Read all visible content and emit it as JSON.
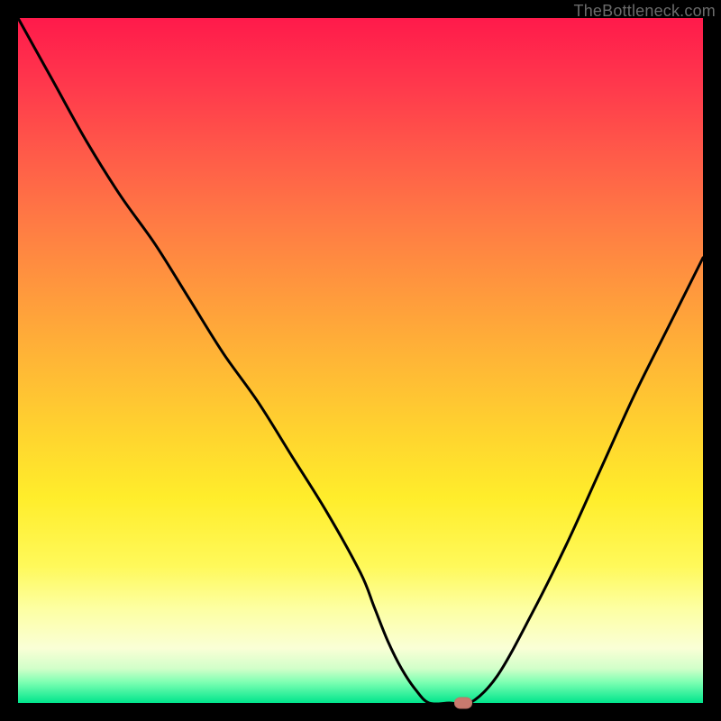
{
  "watermark": "TheBottleneck.com",
  "chart_data": {
    "type": "line",
    "title": "",
    "xlabel": "",
    "ylabel": "",
    "xlim": [
      0,
      100
    ],
    "ylim": [
      0,
      100
    ],
    "grid": false,
    "series": [
      {
        "name": "curve",
        "x": [
          0,
          5,
          10,
          15,
          20,
          25,
          30,
          35,
          40,
          45,
          50,
          52,
          54,
          56,
          58,
          60,
          63,
          66,
          70,
          75,
          80,
          85,
          90,
          95,
          100
        ],
        "y": [
          100,
          91,
          82,
          74,
          67,
          59,
          51,
          44,
          36,
          28,
          19,
          14,
          9,
          5,
          2,
          0,
          0,
          0,
          4,
          13,
          23,
          34,
          45,
          55,
          65
        ]
      }
    ],
    "marker": {
      "x": 65,
      "y": 0
    },
    "gradient_stops": [
      {
        "pos": 0,
        "color": "#ff1a4b"
      },
      {
        "pos": 50,
        "color": "#ffd22f"
      },
      {
        "pos": 86,
        "color": "#fdffa0"
      },
      {
        "pos": 100,
        "color": "#00e58c"
      }
    ]
  }
}
